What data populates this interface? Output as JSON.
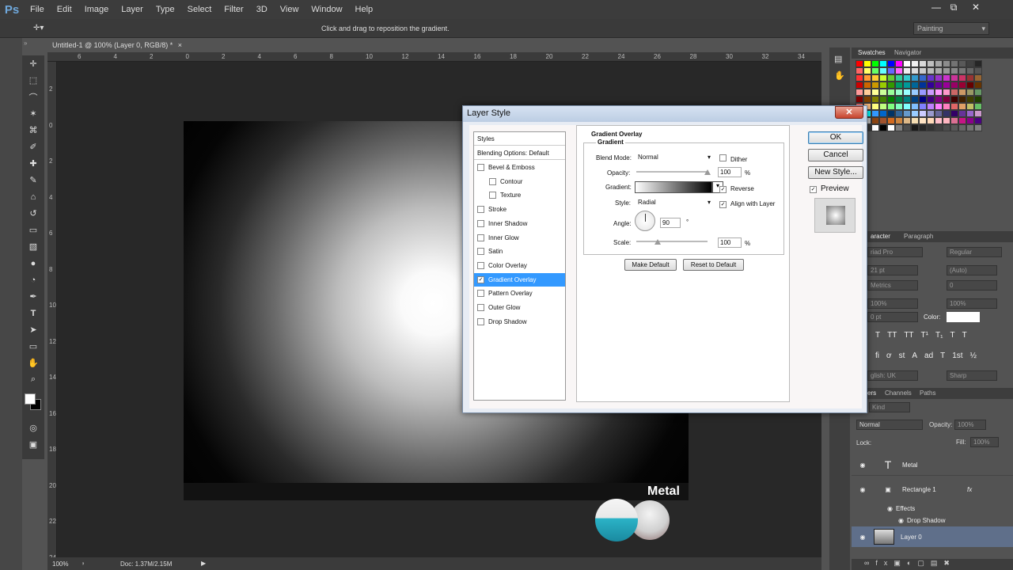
{
  "app": {
    "logo": "Ps"
  },
  "menu": [
    "File",
    "Edit",
    "Image",
    "Layer",
    "Type",
    "Select",
    "Filter",
    "3D",
    "View",
    "Window",
    "Help"
  ],
  "window_controls": {
    "minimize": "—",
    "restore": "⧉",
    "close": "✕"
  },
  "options_bar": {
    "hint": "Click and drag to reposition the gradient.",
    "workspace": "Painting"
  },
  "document": {
    "tab_title": "Untitled-1 @ 100% (Layer 0, RGB/8) *",
    "tab_close": "×",
    "ruler_h": [
      "6",
      "4",
      "2",
      "0",
      "2",
      "4",
      "6",
      "8",
      "10",
      "12",
      "14",
      "16",
      "18",
      "20",
      "22",
      "24",
      "26",
      "28",
      "30",
      "32",
      "34"
    ],
    "ruler_v": [
      "2",
      "0",
      "2",
      "4",
      "6",
      "8",
      "10",
      "12",
      "14",
      "16",
      "18",
      "20",
      "22",
      "24"
    ],
    "zoom": "100%",
    "doc_size": "Doc: 1.37M/2.15M"
  },
  "right_panels": {
    "swatches_tabs": [
      "Swatches",
      "Navigator"
    ],
    "character_tabs": [
      "aracter",
      "Paragraph"
    ],
    "font_family": "riad Pro",
    "font_style": "Regular",
    "font_size": "21 pt",
    "leading": "(Auto)",
    "kerning": "Metrics",
    "tracking": "0",
    "vscale": "100%",
    "hscale": "100%",
    "baseline": "0 pt",
    "color_label": "Color:",
    "language": "glish: UK",
    "antialias": "Sharp",
    "typo_glyphs": [
      "T",
      "TT",
      "TT",
      "T¹",
      "T₁",
      "T",
      "T"
    ],
    "ot_glyphs": [
      "fi",
      "ơ",
      "st",
      "A",
      "ad",
      "T",
      "1st",
      "½"
    ],
    "layers_tabs": [
      "ers",
      "Channels",
      "Paths"
    ],
    "kind_label": "Kind",
    "blend_mode": "Normal",
    "opacity_label": "Opacity:",
    "opacity_value": "100%",
    "lock_label": "Lock:",
    "fill_label": "Fill:",
    "fill_value": "100%",
    "layers": [
      {
        "name": "Metal",
        "type": "T"
      },
      {
        "name": "Rectangle 1",
        "fx": "fx"
      },
      {
        "name": "Effects"
      },
      {
        "name": "Drop Shadow"
      },
      {
        "name": "Layer 0"
      }
    ]
  },
  "swatch_colors": [
    "#ff0000",
    "#ffff00",
    "#00ff00",
    "#00ffff",
    "#0000ff",
    "#ff00ff",
    "#ffffff",
    "#f2f2f2",
    "#d9d9d9",
    "#bfbfbf",
    "#a6a6a6",
    "#8c8c8c",
    "#737373",
    "#595959",
    "#404040",
    "#262626",
    "#ff6666",
    "#ffff66",
    "#66ff66",
    "#66ffff",
    "#6666ff",
    "#ff66ff",
    "#eeeeee",
    "#dddddd",
    "#cccccc",
    "#bbbbbb",
    "#aaaaaa",
    "#999999",
    "#888888",
    "#777777",
    "#666666",
    "#555555",
    "#ff3333",
    "#ff9933",
    "#ffcc33",
    "#ccff33",
    "#66cc33",
    "#33cc99",
    "#33cccc",
    "#3399cc",
    "#3366cc",
    "#6633cc",
    "#9933cc",
    "#cc33cc",
    "#cc3399",
    "#cc3366",
    "#993333",
    "#996633",
    "#cc0000",
    "#cc6600",
    "#cc9900",
    "#99cc00",
    "#339900",
    "#009966",
    "#009999",
    "#006699",
    "#003399",
    "#330099",
    "#660099",
    "#990099",
    "#990066",
    "#990033",
    "#660000",
    "#663300",
    "#ff9999",
    "#ffcc99",
    "#ffff99",
    "#ccff99",
    "#99ff99",
    "#99ffcc",
    "#99ffff",
    "#99ccff",
    "#9999ff",
    "#cc99ff",
    "#ff99ff",
    "#ff99cc",
    "#cc6666",
    "#cc9966",
    "#999966",
    "#669966",
    "#800000",
    "#804000",
    "#808000",
    "#408000",
    "#008000",
    "#008040",
    "#008080",
    "#004080",
    "#000080",
    "#400080",
    "#800080",
    "#800040",
    "#400000",
    "#402000",
    "#404000",
    "#204000",
    "#ff8080",
    "#ffbf80",
    "#ffff80",
    "#bfff80",
    "#80ff80",
    "#80ffbf",
    "#80ffff",
    "#80bfff",
    "#8080ff",
    "#bf80ff",
    "#ff80ff",
    "#ff80bf",
    "#e06666",
    "#e0a066",
    "#c0c066",
    "#66c066",
    "#00bfff",
    "#00ffff",
    "#3399ff",
    "#0066cc",
    "#003366",
    "#336699",
    "#6699cc",
    "#99ccff",
    "#ccccff",
    "#9999cc",
    "#666699",
    "#333366",
    "#330066",
    "#663399",
    "#9966cc",
    "#cc99cc",
    "#ffd700",
    "#c0c0c0",
    "#8b4513",
    "#a0522d",
    "#d2691e",
    "#cd853f",
    "#deb887",
    "#f5deb3",
    "#ffe4c4",
    "#ffdab9",
    "#ffc0cb",
    "#ffb6c1",
    "#db7093",
    "#c71585",
    "#8b008b",
    "#4b0082",
    "#ffff00",
    "#333333",
    "#ffffff",
    "#000000",
    "#ffffff",
    "#7f7f7f",
    "#4d4d4d",
    "#1a1a1a",
    "#262626",
    "#333333",
    "#404040",
    "#4d4d4d",
    "#595959",
    "#666666",
    "#737373",
    "#808080"
  ],
  "dialog": {
    "title": "Layer Style",
    "close": "✕",
    "styles_header": "Styles",
    "blending_options": "Blending Options: Default",
    "style_items": [
      {
        "label": "Bevel & Emboss",
        "checked": false,
        "indent": false
      },
      {
        "label": "Contour",
        "checked": false,
        "indent": true
      },
      {
        "label": "Texture",
        "checked": false,
        "indent": true
      },
      {
        "label": "Stroke",
        "checked": false,
        "indent": false
      },
      {
        "label": "Inner Shadow",
        "checked": false,
        "indent": false
      },
      {
        "label": "Inner Glow",
        "checked": false,
        "indent": false
      },
      {
        "label": "Satin",
        "checked": false,
        "indent": false
      },
      {
        "label": "Color Overlay",
        "checked": false,
        "indent": false
      },
      {
        "label": "Gradient Overlay",
        "checked": true,
        "indent": false,
        "selected": true
      },
      {
        "label": "Pattern Overlay",
        "checked": false,
        "indent": false
      },
      {
        "label": "Outer Glow",
        "checked": false,
        "indent": false
      },
      {
        "label": "Drop Shadow",
        "checked": false,
        "indent": false
      }
    ],
    "section_title": "Gradient Overlay",
    "group_title": "Gradient",
    "blend_mode_label": "Blend Mode:",
    "blend_mode": "Normal",
    "dither_label": "Dither",
    "opacity_label": "Opacity:",
    "opacity_value": "100",
    "opacity_level": 1.0,
    "percent": "%",
    "gradient_label": "Gradient:",
    "reverse_label": "Reverse",
    "style_label": "Style:",
    "style_value": "Radial",
    "align_label": "Align with Layer",
    "angle_label": "Angle:",
    "angle_value": "90",
    "degree": "°",
    "scale_label": "Scale:",
    "scale_value": "100",
    "make_default": "Make Default",
    "reset_default": "Reset to Default",
    "ok": "OK",
    "cancel": "Cancel",
    "new_style": "New Style...",
    "preview_label": "Preview"
  },
  "watermark": {
    "text": "Metal"
  }
}
